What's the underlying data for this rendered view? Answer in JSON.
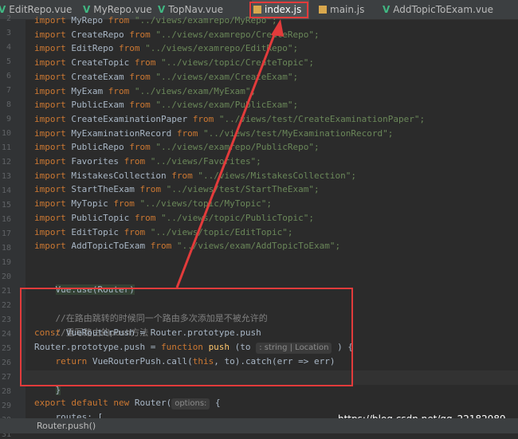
{
  "tabs": [
    {
      "label": "EditRepo.vue",
      "type": "vue",
      "active": false
    },
    {
      "label": "MyRepo.vue",
      "type": "vue",
      "active": false
    },
    {
      "label": "TopNav.vue",
      "type": "vue",
      "active": false
    },
    {
      "label": "index.js",
      "type": "js",
      "active": true
    },
    {
      "label": "main.js",
      "type": "js",
      "active": false
    },
    {
      "label": "AddTopicToExam.vue",
      "type": "vue",
      "active": false
    }
  ],
  "line_numbers": [
    "2",
    "3",
    "4",
    "5",
    "6",
    "7",
    "8",
    "9",
    "10",
    "11",
    "12",
    "13",
    "14",
    "15",
    "16",
    "17",
    "18",
    "19",
    "20",
    "21",
    "22",
    "23",
    "24",
    "25",
    "26",
    "27",
    "28",
    "29",
    "30",
    "31"
  ],
  "imports": [
    {
      "name": "MyRepo",
      "path": "\"../views/examrepo/MyRepo\";"
    },
    {
      "name": "CreateRepo",
      "path": "\"../views/examrepo/CreateRepo\";"
    },
    {
      "name": "EditRepo",
      "path": "\"../views/examrepo/EditRepo\";"
    },
    {
      "name": "CreateTopic",
      "path": "\"../views/topic/CreateTopic\";"
    },
    {
      "name": "CreateExam",
      "path": "\"../views/exam/CreateExam\";"
    },
    {
      "name": "MyExam",
      "path": "\"../views/exam/MyExam\";"
    },
    {
      "name": "PublicExam",
      "path": "\"../views/exam/PublicExam\";"
    },
    {
      "name": "CreateExaminationPaper",
      "path": "\"../views/test/CreateExaminationPaper\";"
    },
    {
      "name": "MyExaminationRecord",
      "path": "\"../views/test/MyExaminationRecord\";"
    },
    {
      "name": "PublicRepo",
      "path": "\"../views/examrepo/PublicRepo\";"
    },
    {
      "name": "Favorites",
      "path": "\"../views/Favorites\";"
    },
    {
      "name": "MistakesCollection",
      "path": "\"../views/MistakesCollection\";"
    },
    {
      "name": "StartTheExam",
      "path": "\"../views/test/StartTheExam\";"
    },
    {
      "name": "MyTopic",
      "path": "\"../views/topic/MyTopic\";"
    },
    {
      "name": "PublicTopic",
      "path": "\"../views/topic/PublicTopic\";"
    },
    {
      "name": "EditTopic",
      "path": "\"../views/topic/EditTopic\";"
    },
    {
      "name": "AddTopicToExam",
      "path": "\"../views/exam/AddTopicToExam\";"
    }
  ],
  "keywords": {
    "import": "import",
    "from": "from",
    "const": "const",
    "function": "function",
    "return": "return",
    "this": "this",
    "export": "export",
    "default": "default",
    "new": "new"
  },
  "code": {
    "vue_use": "Vue.use(Router)",
    "comment1": "//在路由跳转的时候同一个路由多次添加是不被允许的",
    "comment2": "//重写路由的push方法",
    "const_name": "VueRouterPush",
    "const_value": " = Router.prototype.push",
    "assign_lhs": "Router.prototype.push = ",
    "fn_name": "push",
    "fn_open": " (to ",
    "hint_param": ": string | Location",
    "fn_close": " ) {",
    "return_body": " VueRouterPush.call(",
    "return_tail": ", to).catch(err => err)",
    "close_brace": "}",
    "router_ctor": " Router(",
    "hint_options": "options:",
    "router_open": " {",
    "routes_line": "routes: ["
  },
  "status_text": "Router.push()",
  "watermark": "https://blog.csdn.net/qq_22182989"
}
